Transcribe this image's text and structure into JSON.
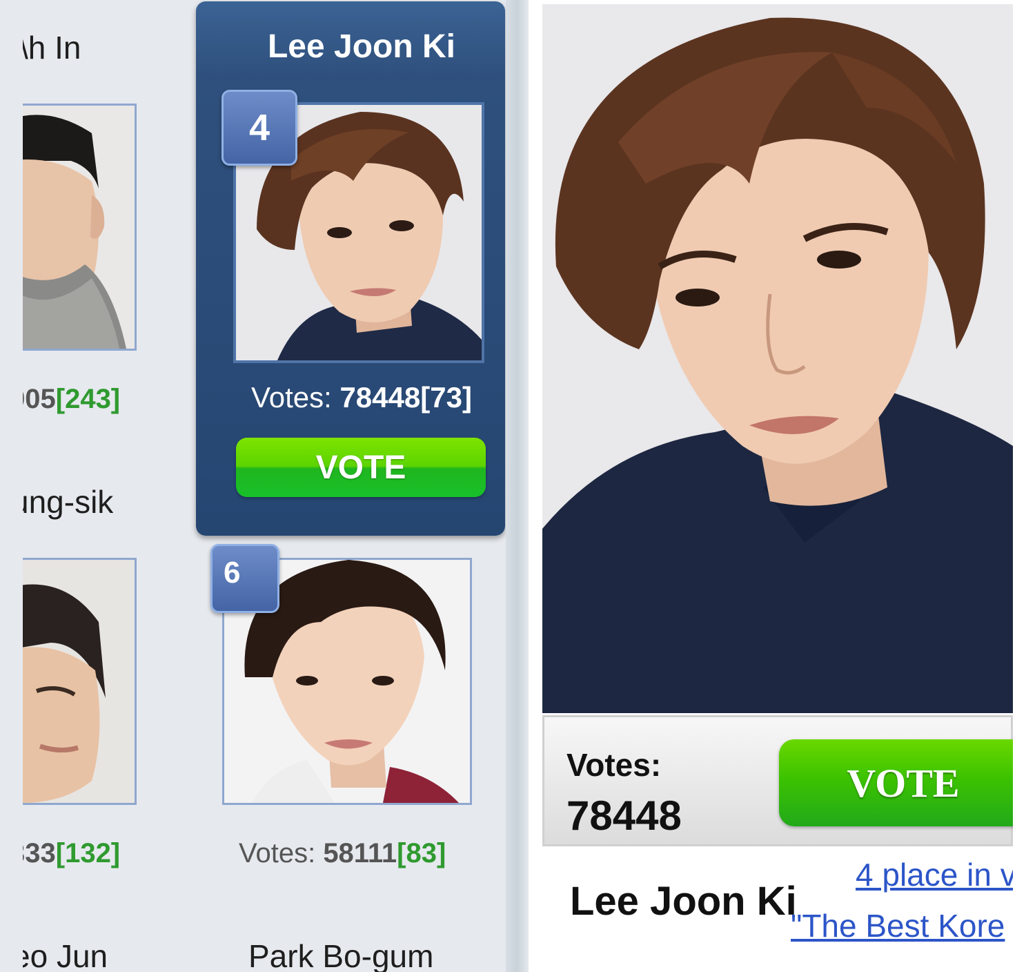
{
  "grid": {
    "left_col": {
      "name_top": "\\h In",
      "votes_top_num": "905",
      "votes_top_delta": "[243]",
      "name_mid": "ung-sik",
      "votes_bottom_num": "333",
      "votes_bottom_delta": "[132]",
      "name_bottom": "eo Jun"
    },
    "highlight_card": {
      "name": "Lee Joon Ki",
      "rank": "4",
      "votes_label": "Votes: ",
      "votes_num": "78448",
      "votes_delta": "[73]",
      "vote_button": "VOTE"
    },
    "next_card": {
      "rank": "6",
      "votes_label": "Votes: ",
      "votes_num": "58111",
      "votes_delta": "[83]",
      "name": "Park Bo-gum"
    }
  },
  "detail": {
    "votes_label": "Votes:",
    "votes_count": "78448",
    "vote_button": "VOTE",
    "name": "Lee Joon Ki",
    "place_link": "4 place in v",
    "category_link": "\"The Best Kore"
  },
  "colors": {
    "card_blue": "#2f507d",
    "vote_green": "#3cc200",
    "delta_green": "#2f9a2f",
    "link_blue": "#2c55c8"
  }
}
